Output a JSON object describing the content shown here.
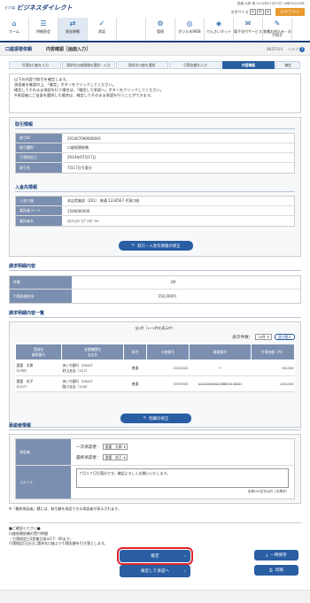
{
  "header": {
    "brand_small": "ﾋﾞｼﾞﾈｽ",
    "brand": "ビジネスダイレクト",
    "user_line": "愛媛 太郎 様 2014年07月25日 16時50分00秒",
    "font_size_label": "文字サイズ",
    "font_sizes": [
      "小",
      "中",
      "大"
    ],
    "logout": "ログアウト"
  },
  "nav": [
    {
      "label": "ホーム",
      "icon": "home-icon",
      "glyph": "⌂"
    },
    {
      "label": "明細照会",
      "icon": "document-icon",
      "glyph": "☰"
    },
    {
      "label": "資金移動",
      "icon": "transfer-icon",
      "glyph": "⇄",
      "active": true
    },
    {
      "label": "承認",
      "icon": "stamp-icon",
      "glyph": "✓"
    },
    {
      "label": "",
      "icon": "blank-icon",
      "glyph": ""
    },
    {
      "label": "管理",
      "icon": "gear-icon",
      "glyph": "⚙"
    },
    {
      "label": "がいためWEB",
      "icon": "globe-icon",
      "glyph": "◎"
    },
    {
      "label": "でんさいネット",
      "icon": "network-icon",
      "glyph": "◈"
    },
    {
      "label": "電子交付サービス",
      "icon": "mail-icon",
      "glyph": "✉"
    },
    {
      "label": "各種お申込み・お手続き",
      "icon": "form-icon",
      "glyph": "✎"
    }
  ],
  "title": {
    "section": "口座振替依頼",
    "page": "内容確認［画面入力］",
    "screen_id": "BKZF010",
    "help": "ヘルプ"
  },
  "steps": [
    "引落先口座を入力",
    "請求先口座情報を選択・入力",
    "請求先口座を選択",
    "引落金額を入力",
    "内容確認",
    "確定"
  ],
  "notice": [
    "以下の内容で取引を確定します。",
    "承認者を確認の上、「確定」ボタンをクリックしてください。",
    "確定してそのまま承認を行う場合は、「確定して承認へ」ボタンをクリックしてください。",
    "※承認者にご自身を選択した場合は、確定してそのまま承認を行うことができます。"
  ],
  "trade_info": {
    "title": "取引情報",
    "rows": [
      {
        "label": "取引ID",
        "value": "201407090000001"
      },
      {
        "label": "取引種別",
        "value": "口座振替依頼"
      },
      {
        "label": "引落指定日",
        "value": "2014年07月17日"
      },
      {
        "label": "取引名",
        "value": "7月17日引落分"
      }
    ]
  },
  "payee_info": {
    "title": "入金先情報",
    "rows": [
      {
        "label": "入金口座",
        "value": "本店営業部（201） 普通 1234567 代表口座"
      },
      {
        "label": "委託者コード",
        "value": "1500000000"
      },
      {
        "label": "委託者名",
        "value": "ｴﾋﾒｼｮｳｼﾞｶﾌﾞｼｷｶﾞｲｼｬ"
      }
    ],
    "button": "取引・入金先情報の修正"
  },
  "claim": {
    "title": "請求明細内容",
    "rows": [
      {
        "label": "件数",
        "value": "2件"
      },
      {
        "label": "引落金額合計",
        "value": "150,000円"
      }
    ]
  },
  "claim_list": {
    "title": "請求明細内容一覧",
    "count_text": "全2件（1～2件を表示中）",
    "per_page_label": "表示件数：",
    "per_page": "10件",
    "reorder": "並び替え",
    "headers": [
      "登録名\n顧客番号",
      "金融機関名\n支店名",
      "科目",
      "口座番号",
      "顧客番号",
      "引落金額（円）"
    ],
    "rows": [
      {
        "name": "愛媛　太郎\nｴﾋﾒﾀﾛｳ",
        "bank": "あいち銀行（0542）\n砂山支店（217）",
        "type": "普通",
        "account": "2222222",
        "cust": "ー",
        "amount": "50,000"
      },
      {
        "name": "愛媛　花子\nｴﾋﾒﾊﾅｺ",
        "bank": "あいち銀行（0542）\n臨川支店（216）",
        "type": "普通",
        "account": "3333333",
        "cust": "AAA200000001BBB30100002",
        "amount": "100,000"
      }
    ],
    "button": "明細の修正"
  },
  "approver": {
    "title": "承認者情報",
    "label_approver": "承認者",
    "label_comment": "コメント",
    "first_label": "一次承認者：",
    "first_value": "愛媛　太郎",
    "final_label": "最終承認者：",
    "final_value": "愛媛　花子",
    "comment": "７月１７日引落分です。確認よろしくお願いいたします。",
    "comment_limit": "全角120文字以内［半角可］"
  },
  "footnotes": [
    "※「最終承認者」欄には、取引額を承認できる承認者が表示されます。",
    "■ご確認ください■",
    "口座振替依頼の受付時間",
    "・引落指定日3営業日前の17：00まで。",
    "引落指定日当日に請求先口座より引落金額を引き落とします。"
  ],
  "buttons": {
    "confirm": "確定",
    "confirm_approve": "確定して承認へ",
    "save": "一時保存",
    "print": "印刷"
  }
}
